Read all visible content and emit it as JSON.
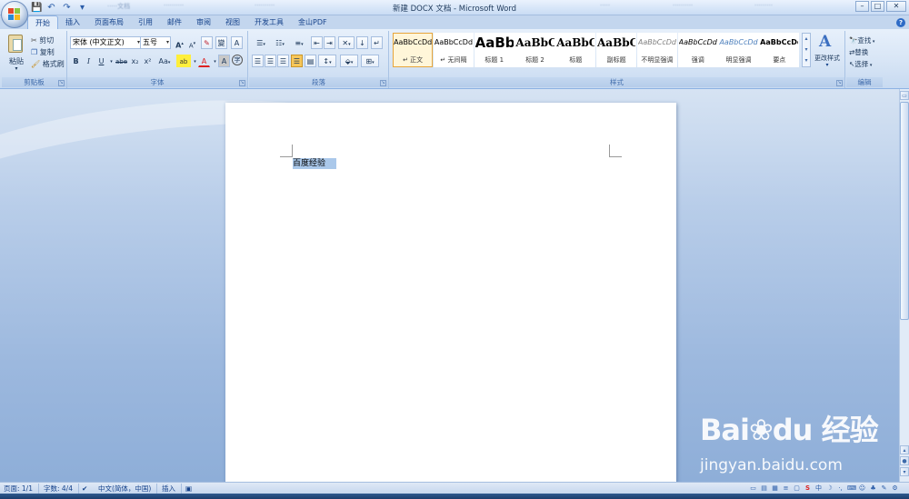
{
  "window": {
    "title": "新建 DOCX 文档 - Microsoft Word",
    "background_tabs": [
      "·····文档",
      "··········",
      "··········",
      "·····",
      "··········",
      "·········"
    ],
    "controls": {
      "minimize": "–",
      "maximize": "□",
      "close": "✕"
    }
  },
  "qat": {
    "save": "💾",
    "undo": "↶",
    "redo": "↷",
    "preview": "▾"
  },
  "tabs": [
    "开始",
    "插入",
    "页面布局",
    "引用",
    "邮件",
    "审阅",
    "视图",
    "开发工具",
    "金山PDF"
  ],
  "ribbon": {
    "clipboard": {
      "label": "剪贴板",
      "paste": "粘贴",
      "cut": "剪切",
      "copy": "复制",
      "format_painter": "格式刷"
    },
    "font": {
      "label": "字体",
      "font_name": "宋体 (中文正文)",
      "font_size": "五号",
      "bold": "B",
      "italic": "I",
      "underline": "U",
      "strike": "abe",
      "subscript": "x₂",
      "superscript": "x²",
      "change_case": "Aa",
      "grow": "A",
      "shrink": "A",
      "clear": "✎",
      "phonetic": "變",
      "border_char": "A",
      "highlight": "ab",
      "font_color": "A",
      "shading": "A",
      "enclose": "字"
    },
    "paragraph": {
      "label": "段落"
    },
    "styles": {
      "label": "样式",
      "change_styles": "更改样式",
      "items": [
        {
          "sample": "AaBbCcDd",
          "name": "↵ 正文"
        },
        {
          "sample": "AaBbCcDd",
          "name": "↵ 无间隔"
        },
        {
          "sample": "AaBb",
          "name": "标题 1"
        },
        {
          "sample": "AaBbC",
          "name": "标题 2"
        },
        {
          "sample": "AaBbC",
          "name": "标题"
        },
        {
          "sample": "AaBbC",
          "name": "副标题"
        },
        {
          "sample": "AaBbCcDd",
          "name": "不明显强调"
        },
        {
          "sample": "AaBbCcDd",
          "name": "强调"
        },
        {
          "sample": "AaBbCcDd",
          "name": "明显强调"
        },
        {
          "sample": "AaBbCcDd",
          "name": "要点"
        }
      ]
    },
    "editing": {
      "label": "编辑",
      "find": "查找",
      "replace": "替换",
      "select": "选择"
    }
  },
  "document": {
    "text": "百度经验"
  },
  "statusbar": {
    "page": "页面: 1/1",
    "words": "字数: 4/4",
    "language": "中文(简体，中国)",
    "mode": "插入"
  },
  "watermark": {
    "logo": "Bai❀du 经验",
    "url": "jingyan.baidu.com"
  },
  "colors": {
    "accent": "#15428b",
    "selection": "#aac8ea",
    "style_active_border": "#e7a53b"
  }
}
